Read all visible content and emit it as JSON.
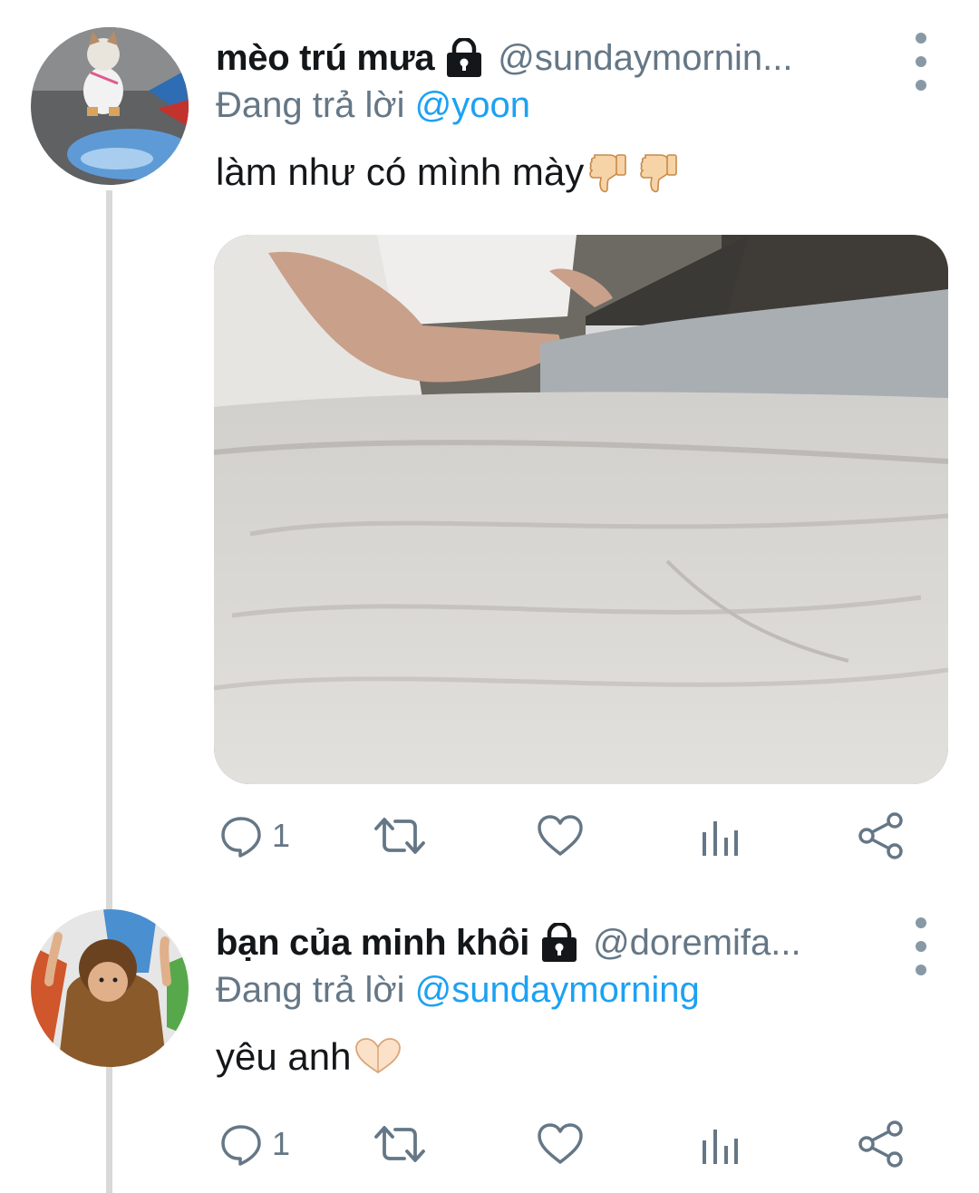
{
  "tweets": [
    {
      "display_name": "mèo trú mưa",
      "handle": "@sundaymornin...",
      "replying_prefix": "Đang trả lời ",
      "replying_to": "@yoon",
      "text": "làm như có mình mày",
      "emoji": [
        "thumbs-down",
        "thumbs-down"
      ],
      "has_media": true,
      "reply_count": "1"
    },
    {
      "display_name": "bạn của minh khôi",
      "handle": "@doremifa...",
      "replying_prefix": "Đang trả lời ",
      "replying_to": "@sundaymorning",
      "text": "yêu anh",
      "emoji": [
        "heart-hands"
      ],
      "has_media": false,
      "reply_count": "1"
    }
  ],
  "colors": {
    "link": "#1da1f2",
    "secondary": "#657786",
    "icon": "#657786",
    "thread_line": "#d9d9d9"
  }
}
